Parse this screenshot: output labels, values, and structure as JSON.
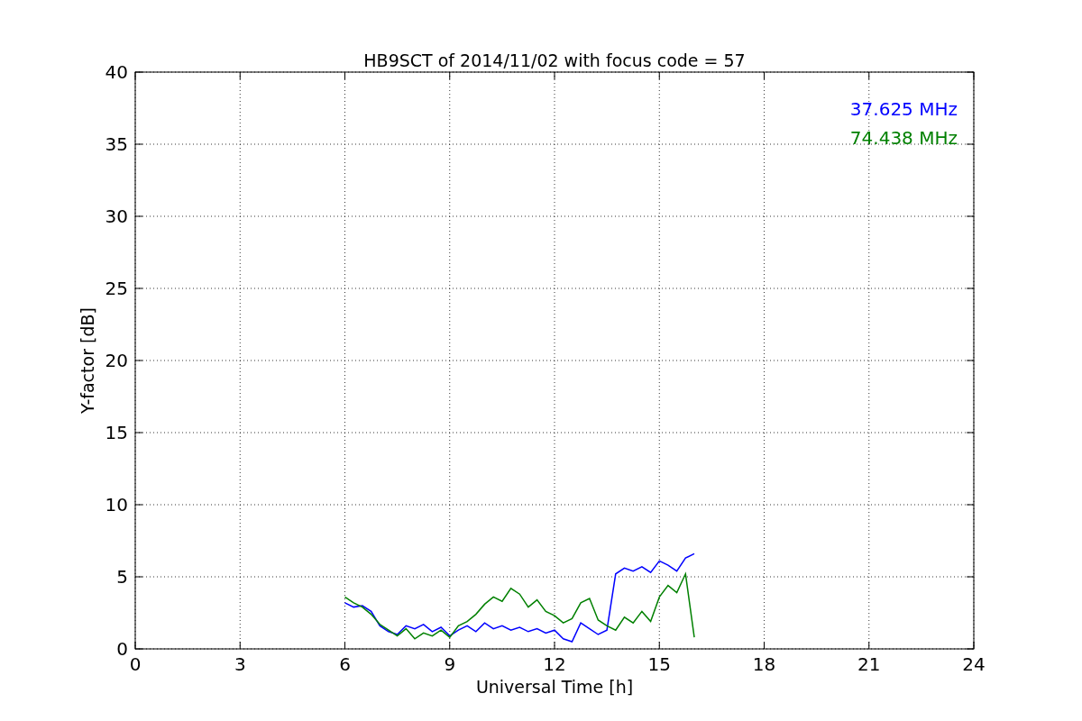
{
  "chart_data": {
    "type": "line",
    "grid": true,
    "title": "HB9SCT of 2014/11/02 with focus code = 57",
    "xlabel": "Universal Time [h]",
    "ylabel": "Y-factor [dB]",
    "xlim": [
      0,
      24
    ],
    "ylim": [
      0,
      40
    ],
    "xticks": [
      0,
      3,
      6,
      9,
      12,
      15,
      18,
      21,
      24
    ],
    "yticks": [
      0,
      5,
      10,
      15,
      20,
      25,
      30,
      35,
      40
    ],
    "x": [
      6.0,
      6.25,
      6.5,
      6.75,
      7.0,
      7.25,
      7.5,
      7.75,
      8.0,
      8.25,
      8.5,
      8.75,
      9.0,
      9.25,
      9.5,
      9.75,
      10.0,
      10.25,
      10.5,
      10.75,
      11.0,
      11.25,
      11.5,
      11.75,
      12.0,
      12.25,
      12.5,
      12.75,
      13.0,
      13.25,
      13.5,
      13.75,
      14.0,
      14.25,
      14.5,
      14.75,
      15.0,
      15.25,
      15.5,
      15.75,
      16.0
    ],
    "series": [
      {
        "name": "37.625 MHz",
        "color": "#0000ff",
        "values": [
          3.2,
          2.9,
          3.0,
          2.6,
          1.6,
          1.2,
          1.0,
          1.6,
          1.4,
          1.7,
          1.2,
          1.5,
          0.9,
          1.3,
          1.6,
          1.2,
          1.8,
          1.4,
          1.6,
          1.3,
          1.5,
          1.2,
          1.4,
          1.1,
          1.3,
          0.7,
          0.5,
          1.8,
          1.4,
          1.0,
          1.3,
          5.2,
          5.6,
          5.4,
          5.7,
          5.3,
          6.1,
          5.8,
          5.4,
          6.3,
          6.6
        ]
      },
      {
        "name": "74.438 MHz",
        "color": "#008000",
        "values": [
          3.6,
          3.2,
          2.9,
          2.4,
          1.7,
          1.3,
          0.9,
          1.4,
          0.7,
          1.1,
          0.9,
          1.3,
          0.8,
          1.6,
          1.9,
          2.4,
          3.1,
          3.6,
          3.3,
          4.2,
          3.8,
          2.9,
          3.4,
          2.6,
          2.3,
          1.8,
          2.1,
          3.2,
          3.5,
          2.0,
          1.6,
          1.3,
          2.2,
          1.8,
          2.6,
          1.9,
          3.6,
          4.4,
          3.9,
          5.2,
          0.8
        ]
      }
    ]
  }
}
